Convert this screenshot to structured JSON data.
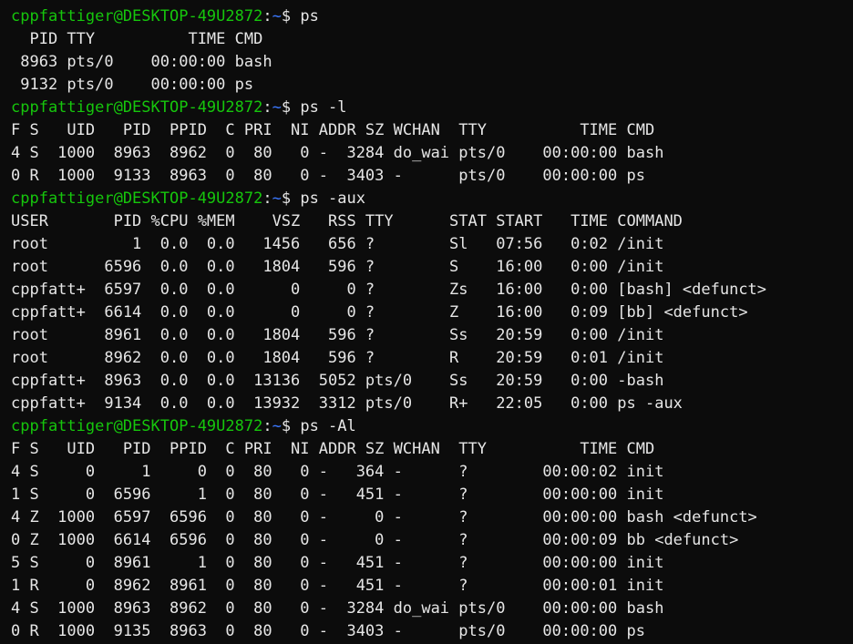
{
  "colors": {
    "background": "#0c0c0c",
    "foreground": "#e6e6e6",
    "prompt_user": "#16c60c",
    "prompt_path": "#3b78ff"
  },
  "terminal": {
    "lines": [
      {
        "kind": "prompt",
        "user": "cppfattiger@DESKTOP-49U2872",
        "sep": ":",
        "path": "~",
        "sym": "$ ",
        "cmd": "ps"
      },
      {
        "kind": "output",
        "text": "  PID TTY          TIME CMD"
      },
      {
        "kind": "output",
        "text": " 8963 pts/0    00:00:00 bash"
      },
      {
        "kind": "output",
        "text": " 9132 pts/0    00:00:00 ps"
      },
      {
        "kind": "prompt",
        "user": "cppfattiger@DESKTOP-49U2872",
        "sep": ":",
        "path": "~",
        "sym": "$ ",
        "cmd": "ps -l"
      },
      {
        "kind": "output",
        "text": "F S   UID   PID  PPID  C PRI  NI ADDR SZ WCHAN  TTY          TIME CMD"
      },
      {
        "kind": "output",
        "text": "4 S  1000  8963  8962  0  80   0 -  3284 do_wai pts/0    00:00:00 bash"
      },
      {
        "kind": "output",
        "text": "0 R  1000  9133  8963  0  80   0 -  3403 -      pts/0    00:00:00 ps"
      },
      {
        "kind": "prompt",
        "user": "cppfattiger@DESKTOP-49U2872",
        "sep": ":",
        "path": "~",
        "sym": "$ ",
        "cmd": "ps -aux"
      },
      {
        "kind": "output",
        "text": "USER       PID %CPU %MEM    VSZ   RSS TTY      STAT START   TIME COMMAND"
      },
      {
        "kind": "output",
        "text": "root         1  0.0  0.0   1456   656 ?        Sl   07:56   0:02 /init"
      },
      {
        "kind": "output",
        "text": "root      6596  0.0  0.0   1804   596 ?        S    16:00   0:00 /init"
      },
      {
        "kind": "output",
        "text": "cppfatt+  6597  0.0  0.0      0     0 ?        Zs   16:00   0:00 [bash] <defunct>"
      },
      {
        "kind": "output",
        "text": "cppfatt+  6614  0.0  0.0      0     0 ?        Z    16:00   0:09 [bb] <defunct>"
      },
      {
        "kind": "output",
        "text": "root      8961  0.0  0.0   1804   596 ?        Ss   20:59   0:00 /init"
      },
      {
        "kind": "output",
        "text": "root      8962  0.0  0.0   1804   596 ?        R    20:59   0:01 /init"
      },
      {
        "kind": "output",
        "text": "cppfatt+  8963  0.0  0.0  13136  5052 pts/0    Ss   20:59   0:00 -bash"
      },
      {
        "kind": "output",
        "text": "cppfatt+  9134  0.0  0.0  13932  3312 pts/0    R+   22:05   0:00 ps -aux"
      },
      {
        "kind": "prompt",
        "user": "cppfattiger@DESKTOP-49U2872",
        "sep": ":",
        "path": "~",
        "sym": "$ ",
        "cmd": "ps -Al"
      },
      {
        "kind": "output",
        "text": "F S   UID   PID  PPID  C PRI  NI ADDR SZ WCHAN  TTY          TIME CMD"
      },
      {
        "kind": "output",
        "text": "4 S     0     1     0  0  80   0 -   364 -      ?        00:00:02 init"
      },
      {
        "kind": "output",
        "text": "1 S     0  6596     1  0  80   0 -   451 -      ?        00:00:00 init"
      },
      {
        "kind": "output",
        "text": "4 Z  1000  6597  6596  0  80   0 -     0 -      ?        00:00:00 bash <defunct>"
      },
      {
        "kind": "output",
        "text": "0 Z  1000  6614  6596  0  80   0 -     0 -      ?        00:00:09 bb <defunct>"
      },
      {
        "kind": "output",
        "text": "5 S     0  8961     1  0  80   0 -   451 -      ?        00:00:00 init"
      },
      {
        "kind": "output",
        "text": "1 R     0  8962  8961  0  80   0 -   451 -      ?        00:00:01 init"
      },
      {
        "kind": "output",
        "text": "4 S  1000  8963  8962  0  80   0 -  3284 do_wai pts/0    00:00:00 bash"
      },
      {
        "kind": "output",
        "text": "0 R  1000  9135  8963  0  80   0 -  3403 -      pts/0    00:00:00 ps"
      }
    ]
  }
}
